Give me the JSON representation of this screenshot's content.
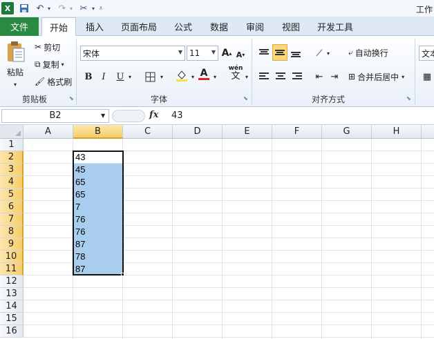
{
  "title": "工作",
  "quick_access": {
    "app_icon": "excel-icon",
    "icons": [
      "save-icon",
      "undo-icon",
      "redo-icon",
      "customize-icon"
    ]
  },
  "tabs": {
    "file": "文件",
    "items": [
      "开始",
      "插入",
      "页面布局",
      "公式",
      "数据",
      "审阅",
      "视图",
      "开发工具"
    ],
    "active": "开始"
  },
  "ribbon": {
    "clipboard": {
      "paste": "粘贴",
      "cut": "剪切",
      "copy": "复制",
      "format_painter": "格式刷",
      "group_label": "剪贴板"
    },
    "font": {
      "font_name": "宋体",
      "font_size": "11",
      "group_label": "字体",
      "bold": "B",
      "italic": "I",
      "underline": "U",
      "grow": "A",
      "shrink": "A",
      "color_a": "A",
      "wen": "wén",
      "wen_char": "文"
    },
    "alignment": {
      "wrap_text": "自动换行",
      "merge_center": "合并后居中",
      "group_label": "对齐方式"
    },
    "number": {
      "format": "文本"
    }
  },
  "formula_bar": {
    "name_box": "B2",
    "fx": "fx",
    "value": "43"
  },
  "sheet": {
    "columns": [
      "A",
      "B",
      "C",
      "D",
      "E",
      "F",
      "G",
      "H"
    ],
    "rows": [
      "1",
      "2",
      "3",
      "4",
      "5",
      "6",
      "7",
      "8",
      "9",
      "10",
      "11",
      "12",
      "13",
      "14",
      "15",
      "16"
    ],
    "selected_column": "B",
    "selected_range": "B2:B11",
    "column_b": [
      "43",
      "45",
      "65",
      "65",
      "7",
      "76",
      "76",
      "87",
      "78",
      "87"
    ]
  },
  "colors": {
    "file_tab": "#2a8a43",
    "selection_fill": "#a9cdee",
    "header_highlight": "#f7cd6a"
  }
}
